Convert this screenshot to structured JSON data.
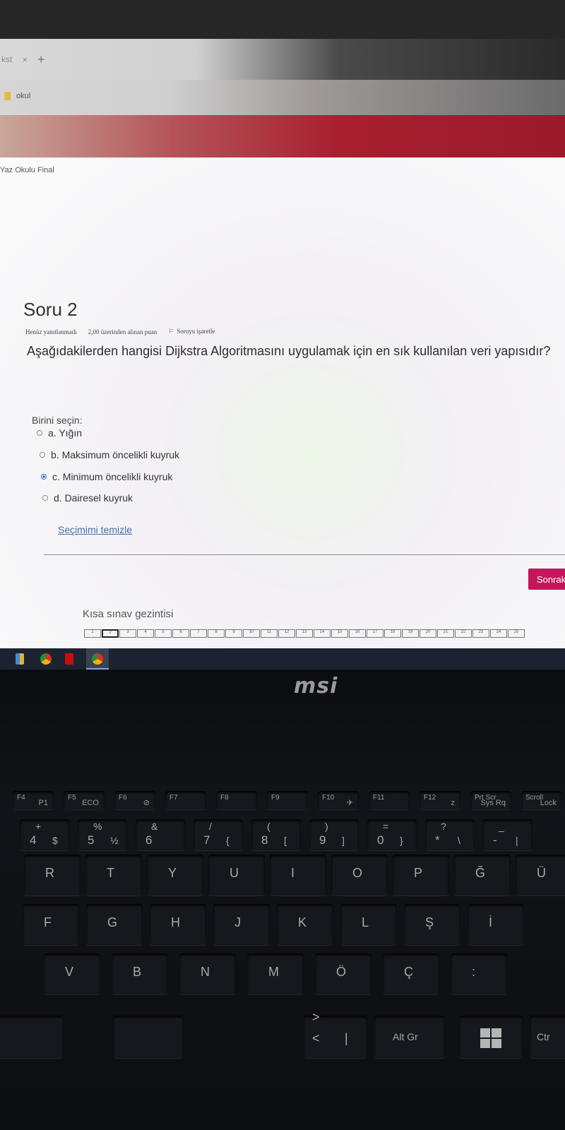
{
  "browser": {
    "tab_title": "kst",
    "tab_close": "×",
    "new_tab": "+",
    "bookmark_label": "okul"
  },
  "page": {
    "course_title": "Yaz Okulu Final",
    "question": {
      "title": "Soru 2",
      "status": "Henüz yanıtlanmadı",
      "points": "2,00 üzerinden alınan puan",
      "flag_label": "Soruyu işaretle",
      "text": "Aşağıdakilerden hangisi Dijkstra Algoritmasını uygulamak için en sık kullanılan veri yapısıdır?",
      "choose_label": "Birini seçin:",
      "options": [
        {
          "label": "a. Yığın",
          "selected": false
        },
        {
          "label": "b. Maksimum öncelikli kuyruk",
          "selected": false
        },
        {
          "label": "c. Minimum öncelikli kuyruk",
          "selected": true
        },
        {
          "label": "d. Dairesel kuyruk",
          "selected": false
        }
      ],
      "clear_label": "Seçimimi temizle"
    },
    "next_button": "Sonrak",
    "quiz_nav": {
      "title": "Kısa sınav gezintisi",
      "numbers": [
        "1",
        "2",
        "3",
        "4",
        "5",
        "6",
        "7",
        "8",
        "9",
        "10",
        "11",
        "12",
        "13",
        "14",
        "15",
        "16",
        "17",
        "18",
        "19",
        "20",
        "21",
        "22",
        "23",
        "24",
        "25"
      ],
      "current": "2"
    }
  },
  "laptop": {
    "brand": "msi",
    "fn_keys": [
      {
        "label": "F4",
        "sub": "P1"
      },
      {
        "label": "F5",
        "sub": "ECO"
      },
      {
        "label": "F6",
        "sub": "⊘"
      },
      {
        "label": "F7",
        "sub": ""
      },
      {
        "label": "F8",
        "sub": ""
      },
      {
        "label": "F9",
        "sub": ""
      },
      {
        "label": "F10",
        "sub": "✈"
      },
      {
        "label": "F11",
        "sub": ""
      },
      {
        "label": "F12",
        "sub": "z"
      },
      {
        "label": "Prt Scr",
        "sub": "Sys Rq"
      },
      {
        "label": "Scroll",
        "sub": "Lock"
      }
    ],
    "num_keys": [
      {
        "top": "+",
        "main": "4",
        "alt": "$"
      },
      {
        "top": "%",
        "main": "5",
        "alt": "½"
      },
      {
        "top": "&",
        "main": "6",
        "alt": ""
      },
      {
        "top": "/",
        "main": "7",
        "alt": "{"
      },
      {
        "top": "(",
        "main": "8",
        "alt": "["
      },
      {
        "top": ")",
        "main": "9",
        "alt": "]"
      },
      {
        "top": "=",
        "main": "0",
        "alt": "}"
      },
      {
        "top": "?",
        "main": "*",
        "alt": "\\"
      },
      {
        "top": "_",
        "main": "-",
        "alt": "|"
      }
    ],
    "row_q": [
      "R",
      "T",
      "Y",
      "U",
      "I",
      "O",
      "P",
      "Ğ",
      "Ü"
    ],
    "row_a": [
      "F",
      "G",
      "H",
      "J",
      "K",
      "L",
      "Ş",
      "İ"
    ],
    "row_z": [
      "V",
      "B",
      "N",
      "M",
      "Ö",
      "Ç",
      ":"
    ],
    "bottom": {
      "altgr": "Alt Gr",
      "ctrl": "Ctr",
      "arrow": ">",
      "lt": "<",
      "pipe": "|"
    }
  }
}
